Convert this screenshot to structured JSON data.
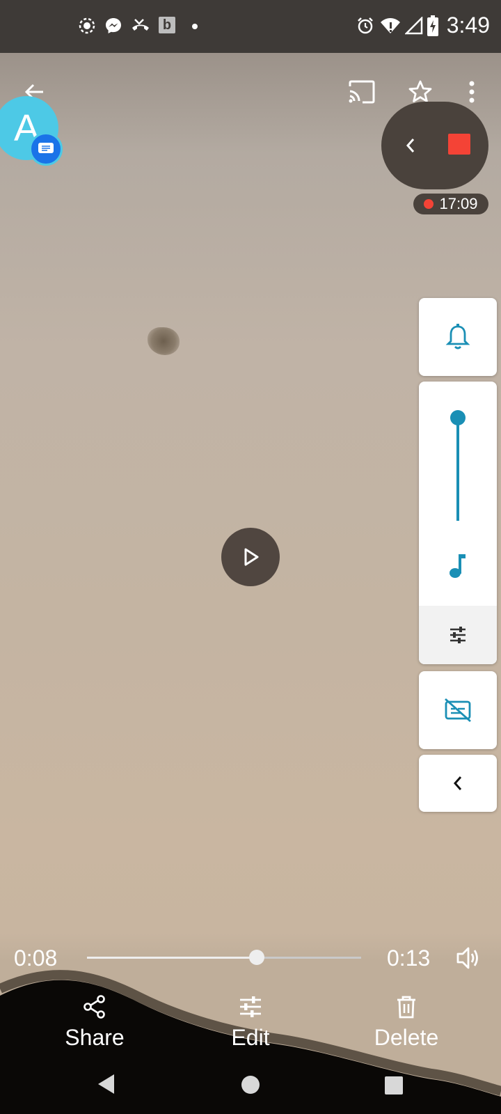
{
  "status_bar": {
    "time": "3:49",
    "left_icons": [
      "screen-record-icon",
      "messenger-icon",
      "missed-call-icon",
      "b-app-icon",
      "dot-icon"
    ],
    "right_icons": [
      "alarm-icon",
      "wifi-icon",
      "signal-icon",
      "battery-charging-icon"
    ]
  },
  "top_bar": {
    "icons": [
      "back-arrow-icon",
      "cast-icon",
      "star-icon",
      "more-vert-icon"
    ]
  },
  "chat_head": {
    "letter": "A"
  },
  "recorder": {
    "timer": "17:09",
    "icons": [
      "chevron-left-icon",
      "stop-icon"
    ]
  },
  "volume_panel": {
    "ring_icon": "bell-icon",
    "media_icon": "music-note-icon",
    "settings_icon": "tune-icon",
    "captions_icon": "captions-off-icon",
    "collapse_icon": "chevron-left-icon",
    "media_level": 1.0
  },
  "player": {
    "elapsed": "0:08",
    "duration": "0:13",
    "progress": 0.62,
    "volume_icon": "volume-icon"
  },
  "actions": [
    {
      "label": "Share",
      "icon": "share-icon"
    },
    {
      "label": "Edit",
      "icon": "tune-icon"
    },
    {
      "label": "Delete",
      "icon": "trash-icon"
    }
  ],
  "nav_bar": {
    "icons": [
      "nav-back-icon",
      "nav-home-icon",
      "nav-recents-icon"
    ]
  },
  "colors": {
    "accent": "#1a8fb5",
    "record_red": "#f44336",
    "avatar": "#4dc9e6"
  }
}
